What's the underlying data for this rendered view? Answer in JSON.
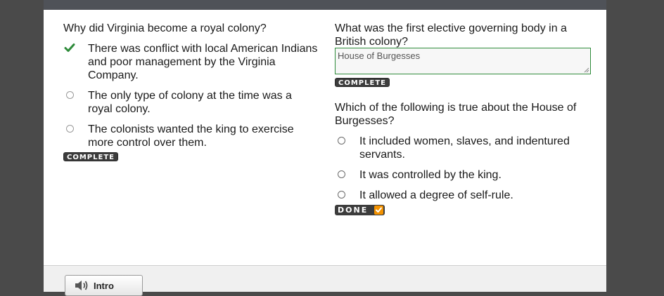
{
  "left_question": {
    "prompt": "Why did Virginia become a royal colony?",
    "options": [
      {
        "text": "There was conflict with local American Indians and poor management by the Virginia Company.",
        "selected": true
      },
      {
        "text": "The only type of colony at the time was a royal colony.",
        "selected": false
      },
      {
        "text": "The colonists wanted the king to exercise more control over them.",
        "selected": false
      }
    ],
    "status": "COMPLETE"
  },
  "right_question_1": {
    "prompt": "What was the first elective governing body in a British colony?",
    "answer": "House of Burgesses",
    "status": "COMPLETE"
  },
  "right_question_2": {
    "prompt": "Which of the following is true about the House of Burgesses?",
    "options": [
      {
        "text": "It included women, slaves, and indentured servants."
      },
      {
        "text": "It was controlled by the king."
      },
      {
        "text": "It allowed a degree of self-rule."
      }
    ],
    "status": "DONE"
  },
  "footer": {
    "intro_label": "Intro"
  },
  "colors": {
    "check_green": "#2e8b3a",
    "done_orange": "#f39200",
    "badge_dark": "#3c3c3c"
  }
}
